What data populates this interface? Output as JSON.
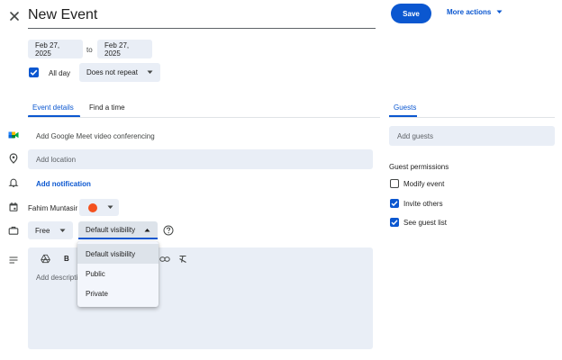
{
  "header": {
    "title": "New Event",
    "save_label": "Save",
    "more_actions_label": "More actions"
  },
  "dates": {
    "start": "Feb 27, 2025",
    "separator": "to",
    "end": "Feb 27, 2025",
    "all_day_label": "All day",
    "all_day_checked": true,
    "repeat": "Does not repeat"
  },
  "tabs": [
    {
      "label": "Event details",
      "active": true
    },
    {
      "label": "Find a time",
      "active": false
    }
  ],
  "details": {
    "meet_label": "Add Google Meet video conferencing",
    "location_placeholder": "Add location",
    "notification_label": "Add notification",
    "organizer": "Fahim Muntasir",
    "event_color": "#f4511e",
    "availability": "Free",
    "visibility": "Default visibility",
    "description_placeholder": "Add description",
    "toolbar_bold": "B"
  },
  "visibility_menu": {
    "items": [
      {
        "label": "Default visibility",
        "selected": true
      },
      {
        "label": "Public",
        "selected": false
      },
      {
        "label": "Private",
        "selected": false
      }
    ]
  },
  "guests": {
    "tab_label": "Guests",
    "add_placeholder": "Add guests",
    "permissions_title": "Guest permissions",
    "permissions": [
      {
        "label": "Modify event",
        "checked": false
      },
      {
        "label": "Invite others",
        "checked": true
      },
      {
        "label": "See guest list",
        "checked": true
      }
    ]
  },
  "colors": {
    "accent": "#0b57d0",
    "field_bg": "#e9eef6"
  }
}
